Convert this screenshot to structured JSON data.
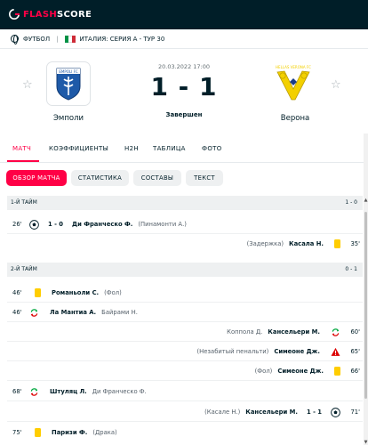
{
  "brand": {
    "flash": "FLASH",
    "score": "SCORE",
    "accent": "#ff0046"
  },
  "breadcrumb": {
    "sport": "ФУТБОЛ",
    "competition": "ИТАЛИЯ: СЕРИЯ А - ТУР 30"
  },
  "match": {
    "datetime": "20.03.2022 17:00",
    "score": "1 - 1",
    "status": "Завершен",
    "home": {
      "name": "Эмполи",
      "logo_text": "EMPOLI FC"
    },
    "away": {
      "name": "Верона",
      "logo_text": "HELLAS VERONA FC"
    }
  },
  "tabs": [
    "МАТЧ",
    "КОЭФФИЦИЕНТЫ",
    "H2H",
    "ТАБЛИЦА",
    "ФОТО"
  ],
  "subtabs": [
    "ОБЗОР МАТЧА",
    "СТАТИСТИКА",
    "СОСТАВЫ",
    "ТЕКСТ"
  ],
  "first_half": {
    "title": "1-Й ТАЙМ",
    "score": "1 - 0",
    "events": [
      {
        "side": "home",
        "minute": "26'",
        "type": "goal",
        "score": "1 - 0",
        "player": "Ди Франческо Ф.",
        "extra": "(Пинамонти А.)"
      },
      {
        "side": "away",
        "minute": "35'",
        "type": "yellow",
        "player": "Касала Н.",
        "extra": "(Задержка)"
      }
    ]
  },
  "second_half": {
    "title": "2-Й ТАЙМ",
    "score": "0 - 1",
    "events": [
      {
        "side": "home",
        "minute": "46'",
        "type": "yellow",
        "player": "Романьоли С.",
        "extra": "(Фол)"
      },
      {
        "side": "home",
        "minute": "46'",
        "type": "sub",
        "player": "Ла Мантиа А.",
        "extra": "Байрами Н."
      },
      {
        "side": "away",
        "minute": "60'",
        "type": "sub",
        "player": "Кансельери М.",
        "extra": "Коппола Д."
      },
      {
        "side": "away",
        "minute": "65'",
        "type": "missed_penalty",
        "player": "Симеоне Дж.",
        "extra": "(Незабитый пенальти)"
      },
      {
        "side": "away",
        "minute": "66'",
        "type": "yellow",
        "player": "Симеоне Дж.",
        "extra": "(Фол)"
      },
      {
        "side": "home",
        "minute": "68'",
        "type": "sub",
        "player": "Штуляц Л.",
        "extra": "Ди Франческо Ф."
      },
      {
        "side": "away",
        "minute": "71'",
        "type": "goal",
        "score": "1 - 1",
        "player": "Кансельери М.",
        "extra": "(Касале Н.)"
      },
      {
        "side": "home",
        "minute": "75'",
        "type": "yellow",
        "player": "Паризи Ф.",
        "extra": "(Драка)"
      }
    ]
  }
}
